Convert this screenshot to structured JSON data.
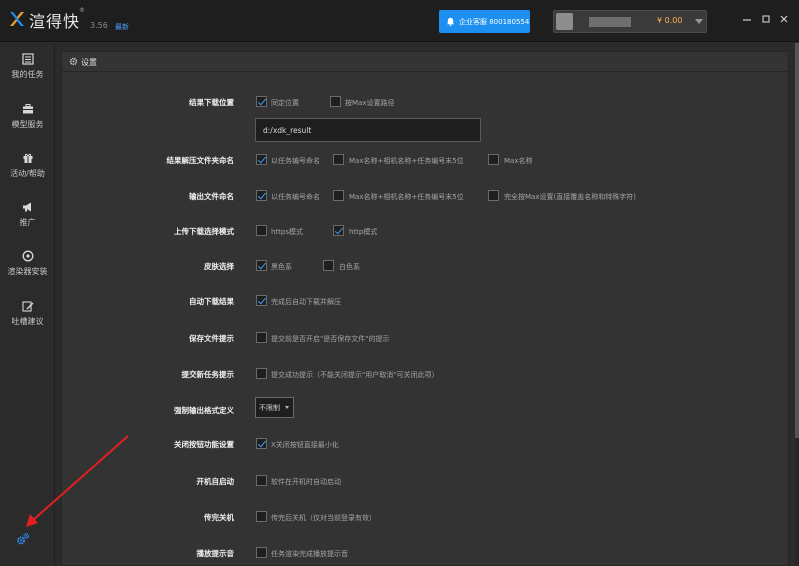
{
  "app": {
    "name": "渲得快",
    "reg_mark": "®",
    "version": "3.56",
    "version_new": "最新"
  },
  "header": {
    "support_label": "企业客服 800180554",
    "balance": "¥ 0.00"
  },
  "sidebar": {
    "items": [
      {
        "label": "我的任务",
        "icon": "task-list-icon"
      },
      {
        "label": "模型服务",
        "icon": "briefcase-icon"
      },
      {
        "label": "活动/帮助",
        "icon": "gift-icon"
      },
      {
        "label": "推广",
        "icon": "megaphone-icon"
      },
      {
        "label": "渲染器安装",
        "icon": "disc-icon"
      },
      {
        "label": "吐槽建议",
        "icon": "edit-icon"
      }
    ],
    "settings_icon": "gears-icon"
  },
  "panel": {
    "title": "设置"
  },
  "settings": {
    "result_location": {
      "label": "结果下载位置",
      "opt1": "同定位置",
      "opt1_checked": true,
      "opt2": "按Max设置路径",
      "opt2_checked": false,
      "path_value": "d:/xdk_result"
    },
    "unzip_naming": {
      "label": "结果解压文件夹命名",
      "opt1": "以任务编号命名",
      "opt1_checked": true,
      "opt2": "Max名称+相机名称+任务编号末5位",
      "opt2_checked": false,
      "opt3": "Max名称",
      "opt3_checked": false
    },
    "output_naming": {
      "label": "输出文件命名",
      "opt1": "以任务编号命名",
      "opt1_checked": true,
      "opt2": "Max名称+相机名称+任务编号末5位",
      "opt2_checked": false,
      "opt3": "完全按Max设置(直接覆盖名称和特殊字符)",
      "opt3_checked": false
    },
    "transfer_mode": {
      "label": "上传下载选择模式",
      "opt1": "https模式",
      "opt1_checked": false,
      "opt2": "http模式",
      "opt2_checked": true
    },
    "skin": {
      "label": "皮肤选择",
      "opt1": "黑色系",
      "opt1_checked": true,
      "opt2": "白色系",
      "opt2_checked": false
    },
    "auto_download": {
      "label": "自动下载结果",
      "opt1": "完成后自动下载并解压",
      "opt1_checked": true
    },
    "save_prompt": {
      "label": "保存文件提示",
      "opt1": "提交前是否开启\"是否保存文件\"的提示",
      "opt1_checked": false
    },
    "submit_success": {
      "label": "提交新任务提示",
      "opt1": "提交成功提示（不能关闭提示\"用户取消\"可关闭此项）",
      "opt1_checked": false
    },
    "output_format": {
      "label": "强制输出格式定义",
      "selected": "不限制"
    },
    "close_behavior": {
      "label": "关闭按钮功能设置",
      "opt1": "X关闭按钮直接最小化",
      "opt1_checked": true
    },
    "autostart": {
      "label": "开机自启动",
      "opt1": "软件在开机时自动启动",
      "opt1_checked": false
    },
    "shutdown": {
      "label": "传完关机",
      "opt1": "传完后关机（仅对当前登录有效）",
      "opt1_checked": false
    },
    "sound": {
      "label": "播放提示音",
      "opt1": "任务渲染完成播放提示音",
      "opt1_checked": false
    }
  },
  "colors": {
    "accent": "#1c8ff0",
    "check": "#3aa0ff",
    "annotation_arrow": "#e02020"
  }
}
